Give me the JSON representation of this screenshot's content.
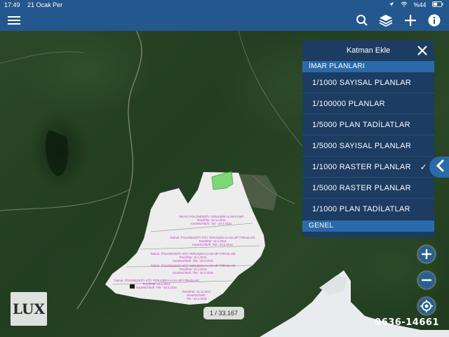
{
  "status_bar": {
    "time": "17:49",
    "date": "21 Ocak Per",
    "battery": "%44",
    "icons": [
      "location-arrow-icon",
      "wifi-icon",
      "battery-icon"
    ]
  },
  "navbar": {
    "icons": [
      "menu-icon",
      "search-icon",
      "layers-icon",
      "add-icon",
      "info-icon"
    ]
  },
  "layer_panel": {
    "title": "Katman Ekle",
    "section_imar": "İMAR PLANLARI",
    "items": [
      {
        "label": "1/1000 SAYISAL PLANLAR",
        "checked": false
      },
      {
        "label": "1/100000 PLANLAR",
        "checked": false
      },
      {
        "label": "1/5000 PLAN TADİLATLAR",
        "checked": false
      },
      {
        "label": "1/5000 SAYISAL PLANLAR",
        "checked": false
      },
      {
        "label": "1/1000 RASTER PLANLAR",
        "checked": true
      },
      {
        "label": "1/5000 RASTER PLANLAR",
        "checked": false
      },
      {
        "label": "1/1000 PLAN TADİLATLAR",
        "checked": false
      }
    ],
    "section_genel": "GENEL",
    "check_mark": "✓"
  },
  "map": {
    "page_counter": "1 / 33.167",
    "phone": "9636-14661",
    "logo": "LUX",
    "parcel_labels": [
      {
        "line1": "TasAdı: POLONEZKÖY YERLEŞİM ALANI KAMP",
        "line2": "TescilliTar: 22.11.2011",
        "line3": "KararNo/Tarih: 754 - 20.4.2016"
      },
      {
        "line1": "TadAdı: POLONEZKÖY KÖY YERLEŞİM ALANI UİP İTİRAZLARI",
        "line2": "TescilliTar: 15.1.2014",
        "line3": "KararNo/Tarih: 755 - 20.4.2016"
      },
      {
        "line1": "TadAdı: POLONEZKÖY KÖY YERLEŞİM ALANI UİP İTİRAZLARI",
        "line2": "TescilliTar: 15.1.2014",
        "line3": "KararNo/Tarih: 755 - 20.4.2016"
      },
      {
        "line1": "TadAdı: POLONEZKÖY KÖY YERLEŞİM ALANI UİP İTİRAZLARI",
        "line2": "TescilliTar: 15.1.2014",
        "line3": "KararNo/Tarih: 755 - 20.4.2016"
      },
      {
        "line1": "TadAdı: POLONEZKÖY KÖY YERLEŞİM ALANI UİP İTİRAZLARI",
        "line2": "TescilliTar: 15.1.2014",
        "line3": "KararNo/Tarih: 755 - 20.4.2016"
      },
      {
        "line1": "TescilliTar: 22.11.2011",
        "line2": "KararNo/Tarih:",
        "line3": "754 - 20.4.2016"
      }
    ]
  },
  "controls": {
    "icons": [
      "zoom-in-icon",
      "zoom-out-icon",
      "my-location-icon",
      "chevron-left-icon"
    ]
  },
  "colors": {
    "navbar": "#24578e",
    "panel": "#1c3c62",
    "section": "#2a6aa8",
    "parcel_text": "#c23cc4"
  }
}
